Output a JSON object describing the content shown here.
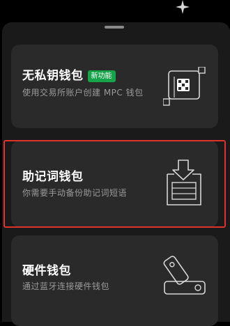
{
  "wallets": [
    {
      "title": "无私钥钱包",
      "badge": "新功能",
      "description": "使用交易所账户创建 MPC 钱包",
      "icon": "mpc-chip-icon"
    },
    {
      "title": "助记词钱包",
      "description": "你需要手动备份助记词短语",
      "icon": "download-tray-icon"
    },
    {
      "title": "硬件钱包",
      "description": "通过蓝牙连接硬件钱包",
      "icon": "usb-key-icon"
    }
  ],
  "colors": {
    "background": "#000000",
    "sheet": "#1a1a1a",
    "card": "#2a2a2a",
    "badge": "#16a34a",
    "highlight": "#e0332c"
  }
}
